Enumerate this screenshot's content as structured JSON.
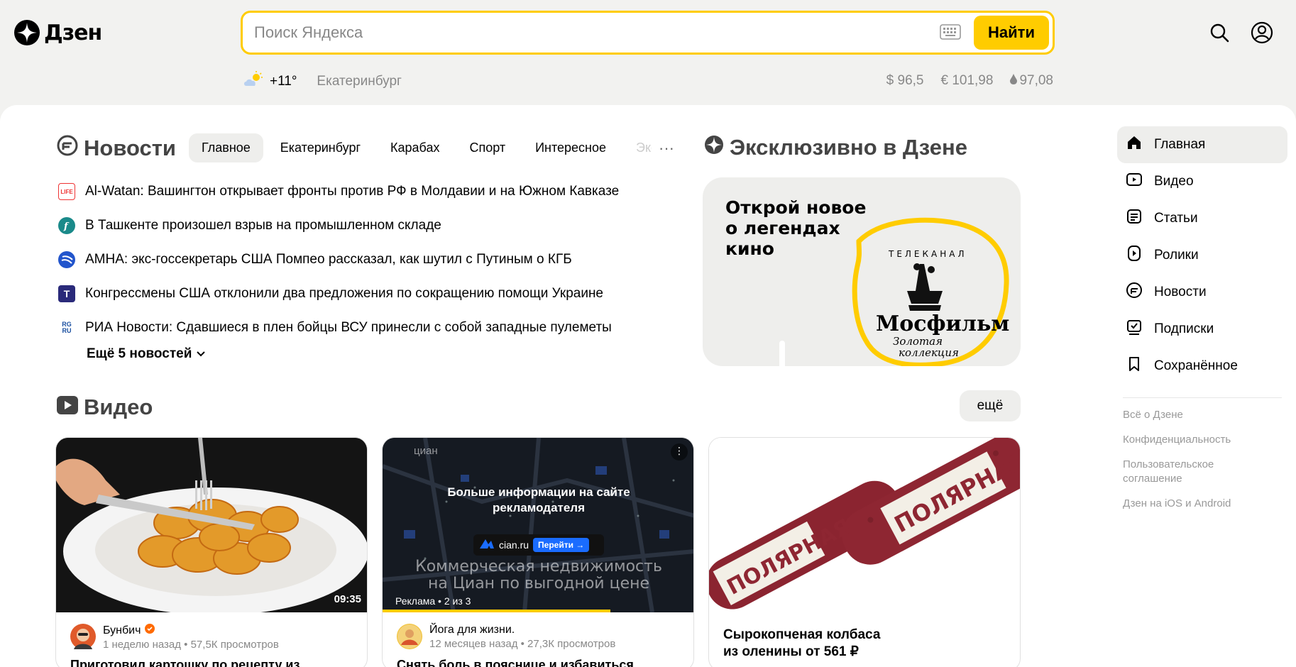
{
  "header": {
    "logo_text": "Дзен",
    "search_placeholder": "Поиск Яндекса",
    "search_button": "Найти",
    "weather_temp": "+11°",
    "city": "Екатеринбург",
    "rates": {
      "usd": "$ 96,5",
      "eur": "€ 101,98",
      "oil": "97,08"
    }
  },
  "news": {
    "title": "Новости",
    "tabs": [
      "Главное",
      "Екатеринбург",
      "Карабах",
      "Спорт",
      "Интересное",
      "Экс"
    ],
    "active_tab": "Главное",
    "items": [
      {
        "source_badge": "LIFE",
        "text": "Al-Watan: Вашингтон открывает фронты против РФ в Молдавии и на Южном Кавказе"
      },
      {
        "source_badge": "",
        "text": "В Ташкенте произошел взрыв на промышленном складе"
      },
      {
        "source_badge": "",
        "text": "АМНА: экс-госсекретарь США Помпео рассказал, как шутил с Путиным о КГБ"
      },
      {
        "source_badge": "T",
        "text": "Конгрессмены США отклонили два предложения по сокращению помощи Украине"
      },
      {
        "source_badge": "RG RU",
        "text": "РИА Новости: Сдавшиеся в плен бойцы ВСУ принесли с собой западные пулеметы"
      }
    ],
    "more_label": "Ещё 5 новостей"
  },
  "exclusive": {
    "title": "Эксклюзивно в Дзене",
    "card_text": [
      "Открой новое",
      "о легендах",
      "кино"
    ],
    "brand_caption": "ТЕЛЕКАНАЛ",
    "brand_name": "Мосфильм",
    "brand_sub": [
      "Золотая",
      "коллекция"
    ]
  },
  "video": {
    "title": "Видео",
    "more_button": "ещё",
    "cards": [
      {
        "duration": "09:35",
        "channel": "Бунбич",
        "verified": true,
        "stats": "1 неделю назад • 57,5К просмотров",
        "title": "Приготовил картошку по рецепту из"
      },
      {
        "ad_overlay": [
          "Больше информации на сайте",
          "рекламодателя"
        ],
        "ad_site": "cian.ru",
        "ad_button": "Перейти →",
        "ad_big_text": [
          "Коммерческая недвижимость",
          "на Циан по выгодной цене"
        ],
        "ad_label": "Реклама • 2 из 3",
        "ad_logo": "циан",
        "ad_progress": 0.73,
        "channel": "Йога для жизни.",
        "stats": "12 месяцев назад • 27,3К просмотров",
        "title": "Снять боль в пояснице и избавиться"
      },
      {
        "product_text": "ПОЛЯРНАЯ",
        "title_lines": [
          "Сырокопченая колбаса",
          "из оленины от 561 ₽"
        ]
      }
    ]
  },
  "sidebar": {
    "items": [
      {
        "label": "Главная",
        "icon": "home-icon",
        "active": true
      },
      {
        "label": "Видео",
        "icon": "video-icon"
      },
      {
        "label": "Статьи",
        "icon": "articles-icon"
      },
      {
        "label": "Ролики",
        "icon": "clips-icon"
      },
      {
        "label": "Новости",
        "icon": "news-icon"
      },
      {
        "label": "Подписки",
        "icon": "subscriptions-icon"
      },
      {
        "label": "Сохранённое",
        "icon": "bookmark-icon"
      }
    ],
    "links": [
      "Всё о Дзене",
      "Конфиденциальность",
      "Пользовательское соглашение",
      "Дзен на iOS и Android"
    ]
  },
  "colors": {
    "accent": "#ffcc00",
    "page_bg": "#f2f2f0",
    "card_bg": "#ffffff",
    "muted": "#888888"
  }
}
